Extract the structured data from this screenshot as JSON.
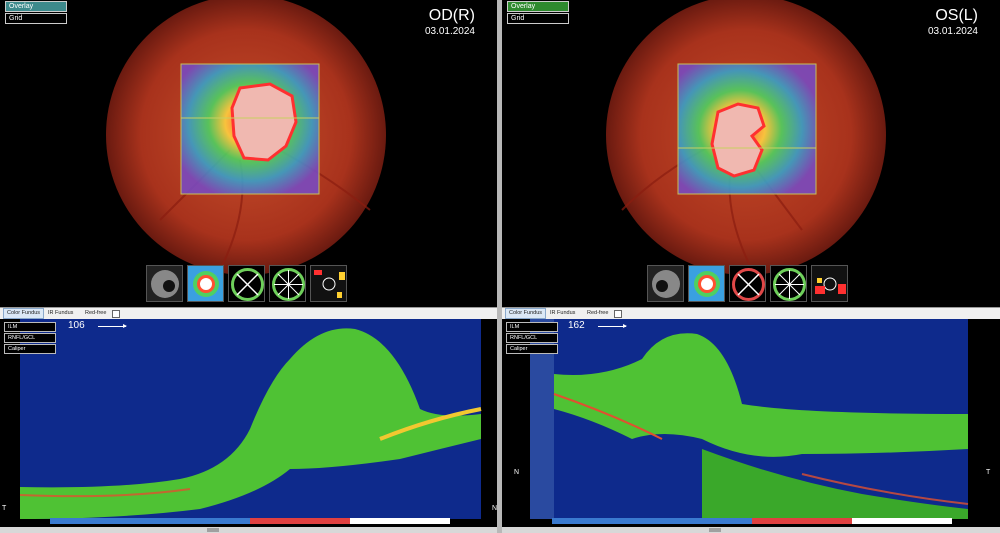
{
  "panels": {
    "left": {
      "eye": "OD(R)",
      "date": "03.01.2024",
      "toggles": {
        "overlay": "Overlay",
        "grid": "Grid"
      },
      "tabs": {
        "color_fundus": "Color Fundus",
        "ir_fundus": "IR Fundus",
        "red_free": "Red-free"
      },
      "layers": {
        "ilm": "ILM",
        "rnfl_gcl": "RNFL/GCL",
        "caliper": "Caliper"
      },
      "slice_number": "106",
      "dir_left": "T",
      "dir_right": "N"
    },
    "right": {
      "eye": "OS(L)",
      "date": "03.01.2024",
      "toggles": {
        "overlay": "Overlay",
        "grid": "Grid"
      },
      "tabs": {
        "color_fundus": "Color Fundus",
        "ir_fundus": "IR Fundus",
        "red_free": "Red-free"
      },
      "layers": {
        "ilm": "ILM",
        "rnfl_gcl": "RNFL/GCL",
        "caliper": "Caliper"
      },
      "slice_number": "162",
      "dir_left": "N",
      "dir_right": "T"
    }
  },
  "thumbnails": [
    "infrared-fundus-thumbnail",
    "thickness-map-thumbnail",
    "circle-scan-thumbnail",
    "radial-scan-thumbnail",
    "deviation-map-thumbnail"
  ],
  "colors": {
    "overlay_active_left": "#3d8a8c",
    "overlay_active_right": "#2e8a2e",
    "fundus_red": "#b23a22",
    "oct_background": "#0e2a8c",
    "oct_tissue": "#4fc234"
  }
}
